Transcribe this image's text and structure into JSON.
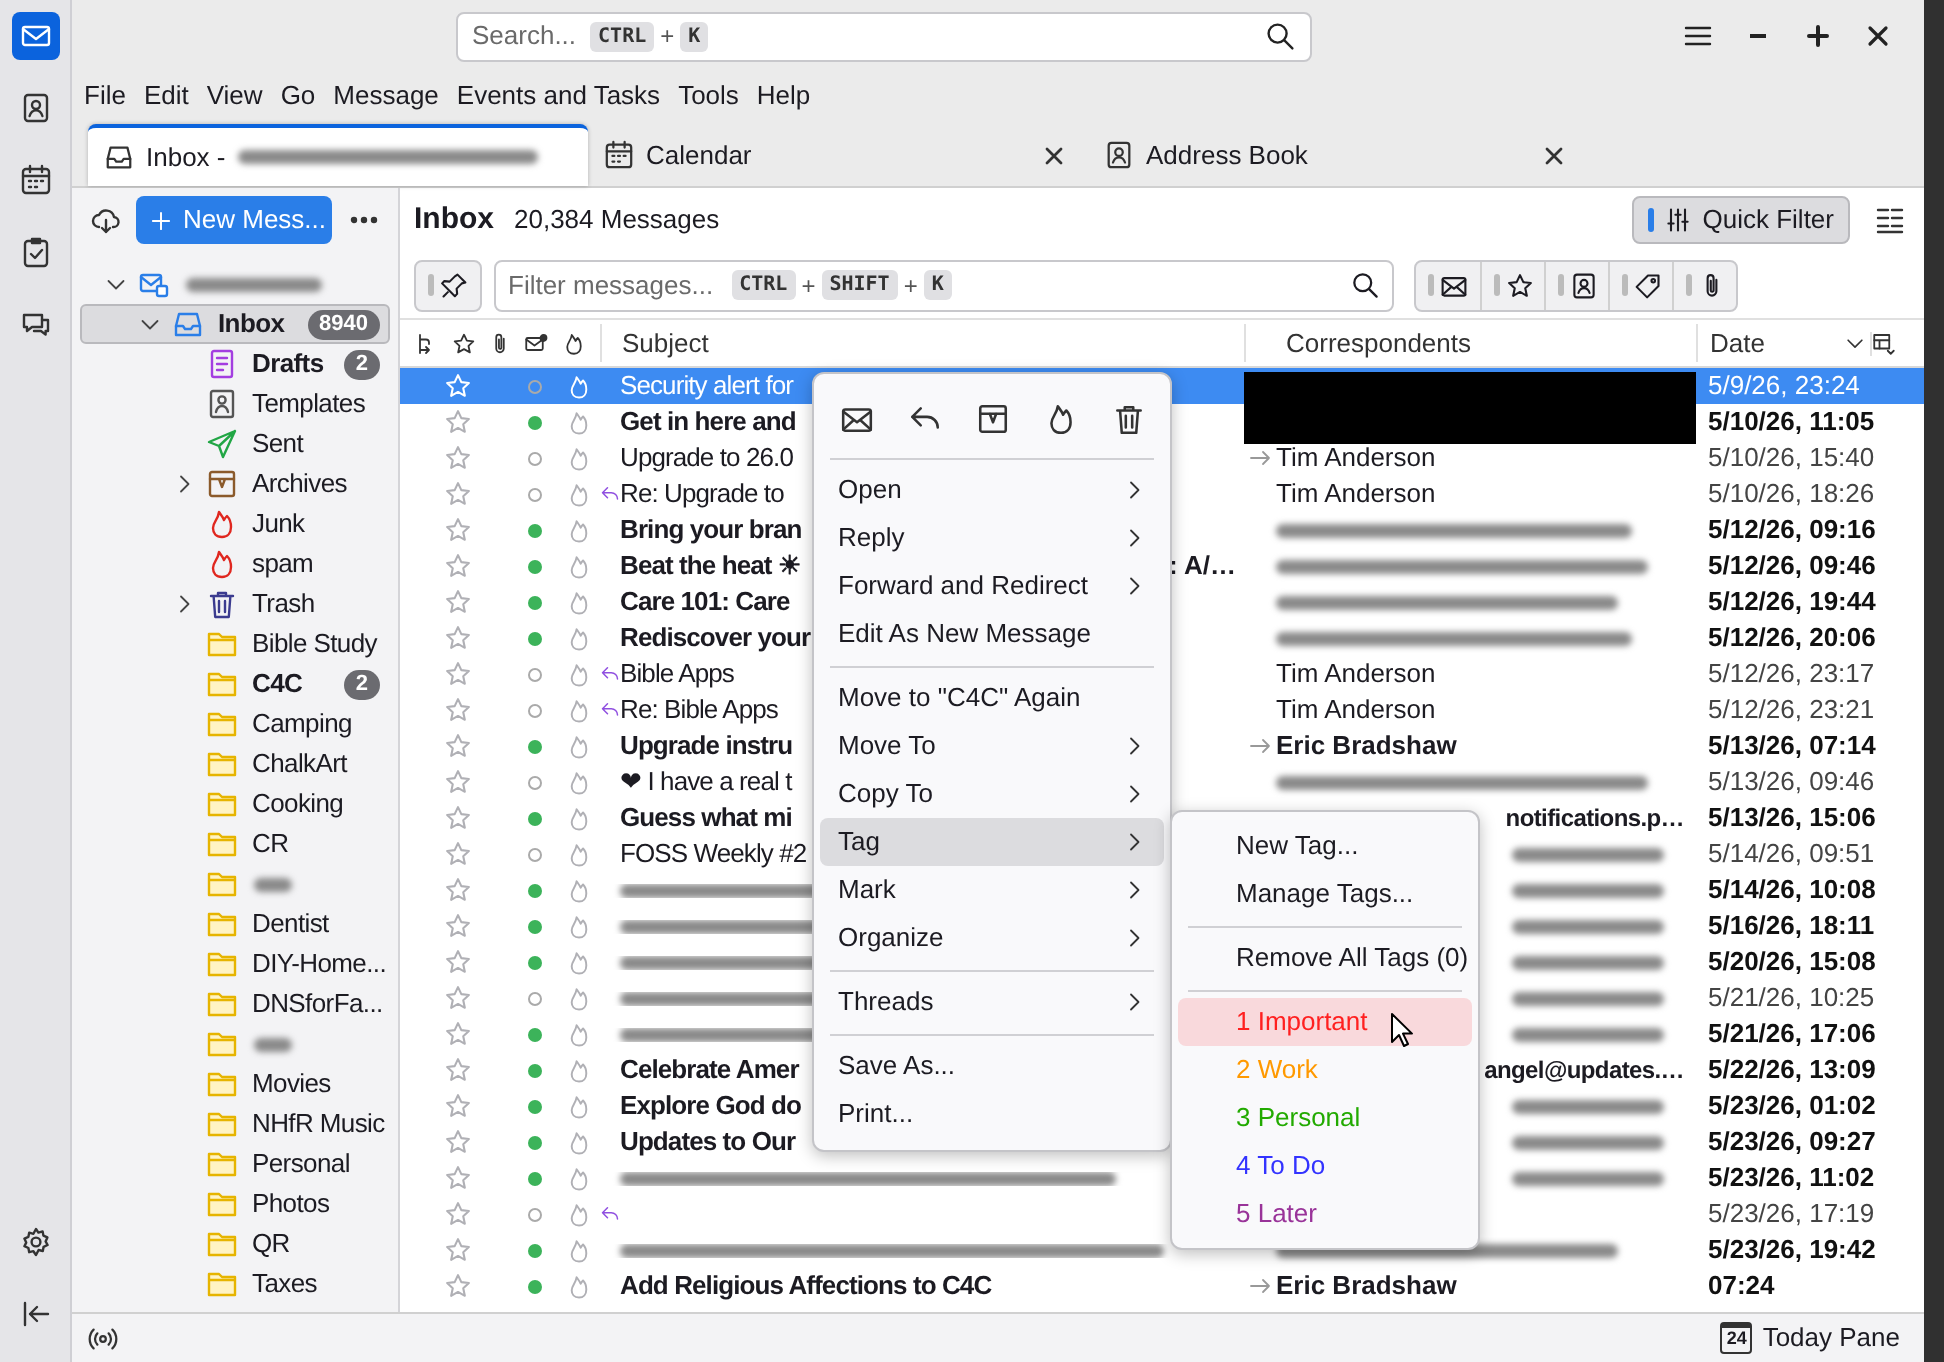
{
  "spaces": [
    {
      "kind": "mail",
      "selected": true
    },
    {
      "kind": "contacts",
      "selected": false
    },
    {
      "kind": "calendar",
      "selected": false
    },
    {
      "kind": "tasks",
      "selected": false
    },
    {
      "kind": "chat",
      "selected": false
    }
  ],
  "search": {
    "placeholder": "Search...",
    "keys": [
      "CTRL",
      "+",
      "K"
    ]
  },
  "menubar": [
    {
      "label": "File"
    },
    {
      "label": "Edit"
    },
    {
      "label": "View"
    },
    {
      "label": "Go"
    },
    {
      "label": "Message"
    },
    {
      "label": "Events and Tasks"
    },
    {
      "label": "Tools"
    },
    {
      "label": "Help"
    }
  ],
  "tabs": [
    {
      "kind": "mail",
      "label": "Inbox - ",
      "blurred_suffix": true,
      "selected": true
    },
    {
      "kind": "calendar",
      "label": "Calendar",
      "selected": false
    },
    {
      "kind": "contacts",
      "label": "Address Book",
      "selected": false
    }
  ],
  "folder_toolbar": {
    "new_message": "New Mess..."
  },
  "folders": [
    {
      "kind": "account",
      "blurred": true,
      "expanded": true,
      "children": [
        {
          "kind": "inbox",
          "name": "Inbox",
          "count": "8940",
          "bold": true,
          "selected": true,
          "expanded": true,
          "children": [
            {
              "kind": "drafts",
              "name": "Drafts",
              "count": "2",
              "bold": true
            },
            {
              "kind": "templates",
              "name": "Templates"
            },
            {
              "kind": "sent",
              "name": "Sent"
            },
            {
              "kind": "archives",
              "name": "Archives",
              "expanded": false
            },
            {
              "kind": "junk",
              "name": "Junk"
            },
            {
              "kind": "junk",
              "name": "spam"
            },
            {
              "kind": "trash",
              "name": "Trash",
              "expanded": false
            },
            {
              "kind": "folder",
              "name": "Bible Study"
            },
            {
              "kind": "folder",
              "name": "C4C",
              "count": "2",
              "bold": true
            },
            {
              "kind": "folder",
              "name": "Camping"
            },
            {
              "kind": "folder",
              "name": "ChalkArt"
            },
            {
              "kind": "folder",
              "name": "Cooking"
            },
            {
              "kind": "folder",
              "name": "CR"
            },
            {
              "kind": "folder",
              "blurred": true
            },
            {
              "kind": "folder",
              "name": "Dentist"
            },
            {
              "kind": "folder",
              "name": "DIY-Home..."
            },
            {
              "kind": "folder",
              "name": "DNSforFa..."
            },
            {
              "kind": "folder",
              "blurred": true
            },
            {
              "kind": "folder",
              "name": "Movies"
            },
            {
              "kind": "folder",
              "name": "NHfR Music"
            },
            {
              "kind": "folder",
              "name": "Personal"
            },
            {
              "kind": "folder",
              "name": "Photos"
            },
            {
              "kind": "folder",
              "name": "QR"
            },
            {
              "kind": "folder",
              "name": "Taxes"
            }
          ]
        }
      ]
    }
  ],
  "message_header": {
    "folder": "Inbox",
    "count": "20,384 Messages",
    "quick_filter": {
      "label": "Quick Filter",
      "on": true
    }
  },
  "filter_bar": {
    "placeholder": "Filter messages...",
    "keys": [
      "CTRL",
      "+",
      "SHIFT",
      "+",
      "K"
    ],
    "toggles": [
      {
        "kind": "unread",
        "on": false
      },
      {
        "kind": "starred",
        "on": false
      },
      {
        "kind": "contact",
        "on": false
      },
      {
        "kind": "tags",
        "on": false
      },
      {
        "kind": "attachment",
        "on": false
      }
    ]
  },
  "columns": {
    "subject": "Subject",
    "correspondents": "Correspondents",
    "date": "Date"
  },
  "rows": [
    {
      "selected": true,
      "unread": false,
      "replied": false,
      "subject": "Security alert for",
      "correspondent": {
        "kind": "censored"
      },
      "date": "5/9/26, 23:24"
    },
    {
      "selected": false,
      "unread": true,
      "replied": false,
      "subject": "Get in here and",
      "correspondent": {
        "kind": "censored"
      },
      "date": "5/10/26, 11:05"
    },
    {
      "selected": false,
      "unread": false,
      "replied": false,
      "subject": "Upgrade to 26.0",
      "correspondent": {
        "kind": "text",
        "name": "Tim Anderson",
        "outgoing": true
      },
      "date": "5/10/26, 15:40"
    },
    {
      "selected": false,
      "unread": false,
      "replied": true,
      "subject": "Re: Upgrade to",
      "correspondent": {
        "kind": "text",
        "name": "Tim Anderson",
        "outgoing": false
      },
      "date": "5/10/26, 18:26"
    },
    {
      "selected": false,
      "unread": true,
      "replied": false,
      "subject": "Bring your bran",
      "correspondent": {
        "kind": "blurred"
      },
      "date": "5/12/26, 09:16"
    },
    {
      "selected": false,
      "unread": true,
      "replied": false,
      "subject": "Beat the heat ☀",
      "subject_tail": ": A/…",
      "correspondent": {
        "kind": "blurred"
      },
      "date": "5/12/26, 09:46"
    },
    {
      "selected": false,
      "unread": true,
      "replied": false,
      "subject": "Care 101: Care",
      "correspondent": {
        "kind": "blurred"
      },
      "date": "5/12/26, 19:44"
    },
    {
      "selected": false,
      "unread": true,
      "replied": false,
      "subject": "Rediscover your",
      "correspondent": {
        "kind": "blurred"
      },
      "date": "5/12/26, 20:06"
    },
    {
      "selected": false,
      "unread": false,
      "replied": true,
      "subject": "Bible Apps",
      "correspondent": {
        "kind": "text",
        "name": "Tim Anderson",
        "outgoing": false
      },
      "date": "5/12/26, 23:17"
    },
    {
      "selected": false,
      "unread": false,
      "replied": true,
      "subject": "Re: Bible Apps",
      "correspondent": {
        "kind": "text",
        "name": "Tim Anderson",
        "outgoing": false
      },
      "date": "5/12/26, 23:21"
    },
    {
      "selected": false,
      "unread": true,
      "replied": false,
      "subject": "Upgrade instru",
      "correspondent": {
        "kind": "text",
        "name": "Eric Bradshaw",
        "outgoing": true
      },
      "date": "5/13/26, 07:14"
    },
    {
      "selected": false,
      "unread": false,
      "replied": false,
      "subject": "❤ I have a real t",
      "correspondent": {
        "kind": "blurred"
      },
      "date": "5/13/26, 09:46"
    },
    {
      "selected": false,
      "unread": true,
      "replied": false,
      "subject": "Guess what mi",
      "correspondent": {
        "kind": "text",
        "name": "notifications.p…",
        "clipped": true
      },
      "date": "5/13/26, 15:06"
    },
    {
      "selected": false,
      "unread": false,
      "replied": false,
      "subject": "FOSS Weekly #2",
      "correspondent": {
        "kind": "blurred",
        "clipped": true
      },
      "date": "5/14/26, 09:51"
    },
    {
      "selected": false,
      "unread": true,
      "replied": false,
      "subject_blurred": true,
      "correspondent": {
        "kind": "blurred",
        "clipped": true
      },
      "date": "5/14/26, 10:08"
    },
    {
      "selected": false,
      "unread": true,
      "replied": false,
      "subject_blurred": true,
      "correspondent": {
        "kind": "blurred",
        "clipped": true
      },
      "date": "5/16/26, 18:11"
    },
    {
      "selected": false,
      "unread": true,
      "replied": false,
      "subject_blurred": true,
      "correspondent": {
        "kind": "blurred",
        "clipped": true
      },
      "date": "5/20/26, 15:08"
    },
    {
      "selected": false,
      "unread": false,
      "replied": false,
      "subject_blurred": true,
      "correspondent": {
        "kind": "blurred",
        "clipped": true
      },
      "date": "5/21/26, 10:25"
    },
    {
      "selected": false,
      "unread": true,
      "replied": false,
      "subject_blurred": true,
      "correspondent": {
        "kind": "blurred",
        "clipped": true
      },
      "date": "5/21/26, 17:06"
    },
    {
      "selected": false,
      "unread": true,
      "replied": false,
      "subject": "Celebrate Amer",
      "correspondent": {
        "kind": "text",
        "name": "angel@updates.…",
        "clipped": true
      },
      "date": "5/22/26, 13:09"
    },
    {
      "selected": false,
      "unread": true,
      "replied": false,
      "subject": "Explore God do",
      "correspondent": {
        "kind": "blurred",
        "clipped": true
      },
      "date": "5/23/26, 01:02"
    },
    {
      "selected": false,
      "unread": true,
      "replied": false,
      "subject": "Updates to Our",
      "correspondent": {
        "kind": "blurred",
        "clipped": true
      },
      "date": "5/23/26, 09:27"
    },
    {
      "selected": false,
      "unread": true,
      "replied": false,
      "subject_blurred": true,
      "correspondent": {
        "kind": "blurred",
        "clipped": true
      },
      "date": "5/23/26, 11:02"
    },
    {
      "selected": false,
      "unread": false,
      "replied": true,
      "correspondent": {
        "kind": "none"
      },
      "date": "5/23/26, 17:19"
    },
    {
      "selected": false,
      "unread": true,
      "replied": false,
      "subject_blurred": true,
      "correspondent": {
        "kind": "blurred"
      },
      "date": "5/23/26, 19:42"
    },
    {
      "selected": false,
      "unread": true,
      "replied": false,
      "subject": "Add Religious Affections to C4C",
      "correspondent": {
        "kind": "text",
        "name": "Eric Bradshaw",
        "outgoing": true
      },
      "date": "07:24"
    }
  ],
  "context_menu": {
    "toolbar": [
      {
        "kind": "mark-read"
      },
      {
        "kind": "reply"
      },
      {
        "kind": "archive"
      },
      {
        "kind": "junk"
      },
      {
        "kind": "delete"
      }
    ],
    "items": [
      {
        "kind": "separator"
      },
      {
        "kind": "item",
        "label": "Open",
        "submenu": true,
        "selected": false
      },
      {
        "kind": "item",
        "label": "Reply",
        "submenu": true,
        "selected": false
      },
      {
        "kind": "item",
        "label": "Forward and Redirect",
        "submenu": true,
        "selected": false
      },
      {
        "kind": "item",
        "label": "Edit As New Message",
        "submenu": false,
        "selected": false
      },
      {
        "kind": "separator"
      },
      {
        "kind": "item",
        "label": "Move to \"C4C\" Again",
        "submenu": false,
        "selected": false
      },
      {
        "kind": "item",
        "label": "Move To",
        "submenu": true,
        "selected": false
      },
      {
        "kind": "item",
        "label": "Copy To",
        "submenu": true,
        "selected": false
      },
      {
        "kind": "item",
        "label": "Tag",
        "submenu": true,
        "selected": true
      },
      {
        "kind": "item",
        "label": "Mark",
        "submenu": true,
        "selected": false
      },
      {
        "kind": "item",
        "label": "Organize",
        "submenu": true,
        "selected": false
      },
      {
        "kind": "separator"
      },
      {
        "kind": "item",
        "label": "Threads",
        "submenu": true,
        "selected": false
      },
      {
        "kind": "separator"
      },
      {
        "kind": "item",
        "label": "Save As...",
        "submenu": false,
        "selected": false
      },
      {
        "kind": "item",
        "label": "Print...",
        "submenu": false,
        "selected": false
      }
    ]
  },
  "tag_menu": [
    {
      "kind": "item",
      "label": "New Tag...",
      "selected": false
    },
    {
      "kind": "item",
      "label": "Manage Tags...",
      "selected": false
    },
    {
      "kind": "separator"
    },
    {
      "kind": "item",
      "label": "Remove All Tags (0)",
      "selected": false
    },
    {
      "kind": "separator"
    },
    {
      "kind": "tag",
      "label": "1 Important",
      "color": "#ff2020",
      "selected": true
    },
    {
      "kind": "tag",
      "label": "2 Work",
      "color": "#ff9900",
      "selected": false
    },
    {
      "kind": "tag",
      "label": "3 Personal",
      "color": "#22aa00",
      "selected": false
    },
    {
      "kind": "tag",
      "label": "4 To Do",
      "color": "#3333ff",
      "selected": false
    },
    {
      "kind": "tag",
      "label": "5 Later",
      "color": "#993399",
      "selected": false
    }
  ],
  "status_bar": {
    "today_pane": {
      "label": "Today Pane",
      "day": "24"
    }
  }
}
